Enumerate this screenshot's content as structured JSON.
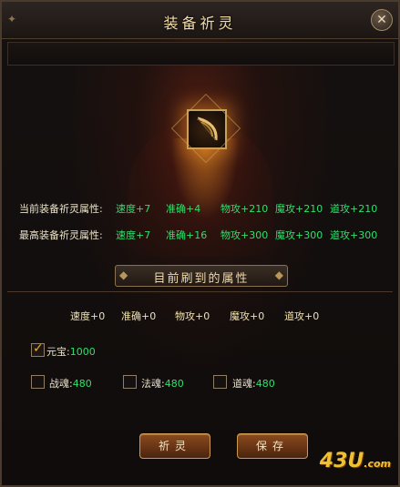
{
  "window": {
    "title": "装备祈灵",
    "close_label": "✕"
  },
  "item_slot": {
    "icon": "bow-icon"
  },
  "current_stats": {
    "label": "当前装备祈灵属性:",
    "values": [
      "速度+7",
      "准确+4",
      "物攻+210",
      "魔攻+210",
      "道攻+210"
    ]
  },
  "max_stats": {
    "label": "最高装备祈灵属性:",
    "values": [
      "速度+7",
      "准确+16",
      "物攻+300",
      "魔攻+300",
      "道攻+300"
    ]
  },
  "banner": {
    "text": "目前刷到的属性"
  },
  "refreshed_stats": [
    {
      "name": "速度",
      "value": "+0"
    },
    {
      "name": "准确",
      "value": "+0"
    },
    {
      "name": "物攻",
      "value": "+0"
    },
    {
      "name": "魔攻",
      "value": "+0"
    },
    {
      "name": "道攻",
      "value": "+0"
    }
  ],
  "options": {
    "yuanbao": {
      "label": "元宝:",
      "value": "1000",
      "checked": true
    },
    "zhanhun": {
      "label": "战魂:",
      "value": "480",
      "checked": false
    },
    "fahun": {
      "label": "法魂:",
      "value": "480",
      "checked": false
    },
    "daohun": {
      "label": "道魂:",
      "value": "480",
      "checked": false
    }
  },
  "buttons": {
    "pray": "祈灵",
    "save": "保存"
  },
  "watermark": {
    "text": "43U",
    "suffix": ".com"
  },
  "colors": {
    "stat_value": "#2ee06b",
    "title": "#f1dba9",
    "check": "#f6a522"
  }
}
